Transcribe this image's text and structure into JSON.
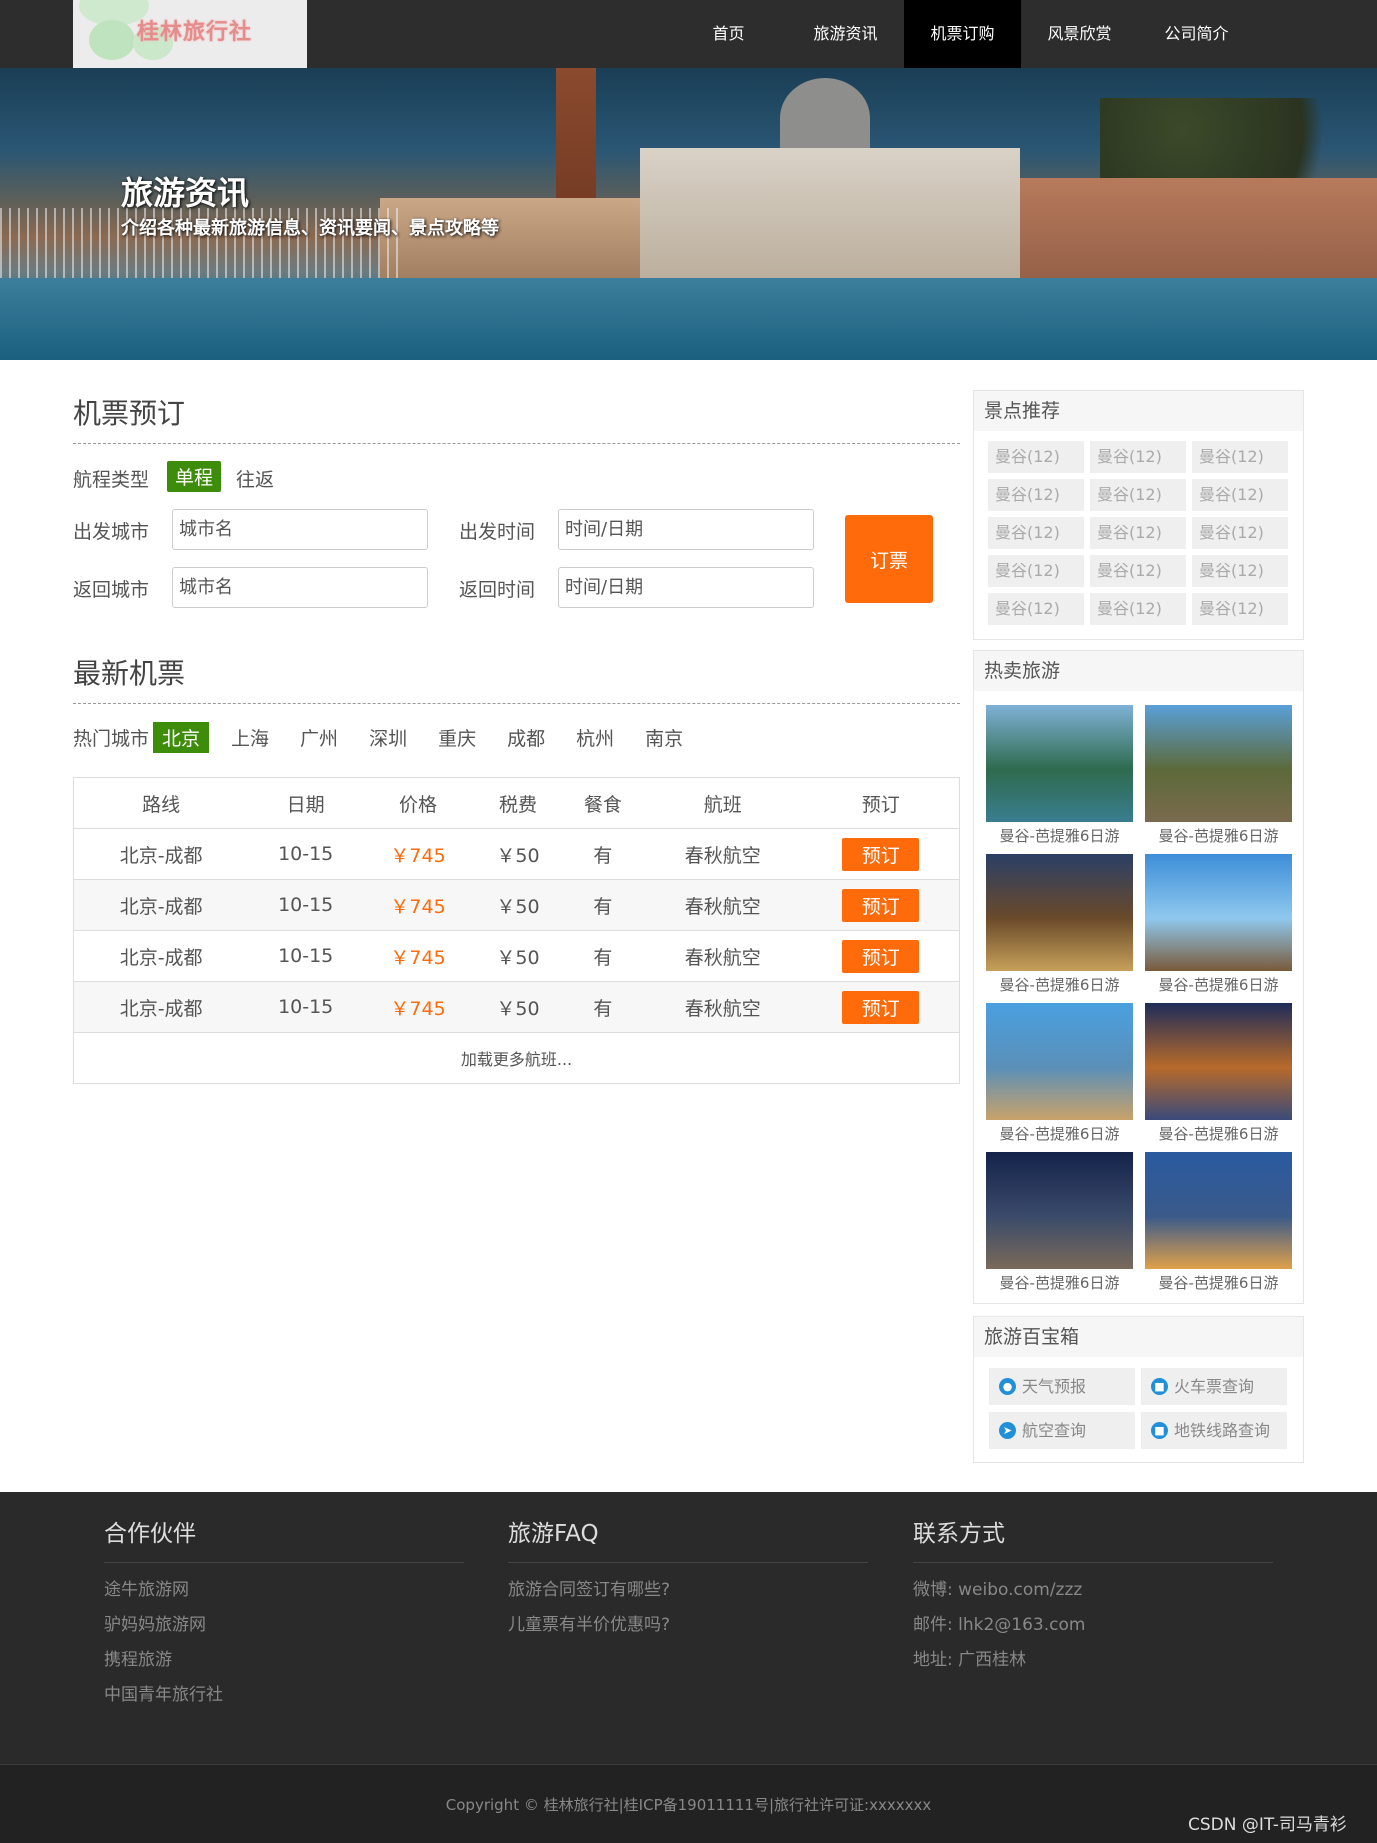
{
  "nav": {
    "logo_text": "桂林旅行社",
    "items": [
      "首页",
      "旅游资讯",
      "机票订购",
      "风景欣赏",
      "公司简介"
    ],
    "active_index": 2
  },
  "banner": {
    "title": "旅游资讯",
    "subtitle": "介绍各种最新旅游信息、资讯要闻、景点攻略等"
  },
  "booking": {
    "title": "机票预订",
    "trip_type_label": "航程类型",
    "trip_types": [
      "单程",
      "往返"
    ],
    "depart_city_label": "出发城市",
    "depart_city_placeholder": "城市名",
    "depart_time_label": "出发时间",
    "depart_time_placeholder": "时间/日期",
    "return_city_label": "返回城市",
    "return_city_placeholder": "城市名",
    "return_time_label": "返回时间",
    "return_time_placeholder": "时间/日期",
    "submit_label": "订票"
  },
  "latest": {
    "title": "最新机票",
    "hot_city_label": "热门城市",
    "cities": [
      "北京",
      "上海",
      "广州",
      "深圳",
      "重庆",
      "成都",
      "杭州",
      "南京"
    ],
    "columns": [
      "路线",
      "日期",
      "价格",
      "税费",
      "餐食",
      "航班",
      "预订"
    ],
    "rows": [
      {
        "route": "北京-成都",
        "date": "10-15",
        "price": "￥745",
        "tax": "￥50",
        "meal": "有",
        "airline": "春秋航空",
        "action": "预订"
      },
      {
        "route": "北京-成都",
        "date": "10-15",
        "price": "￥745",
        "tax": "￥50",
        "meal": "有",
        "airline": "春秋航空",
        "action": "预订"
      },
      {
        "route": "北京-成都",
        "date": "10-15",
        "price": "￥745",
        "tax": "￥50",
        "meal": "有",
        "airline": "春秋航空",
        "action": "预订"
      },
      {
        "route": "北京-成都",
        "date": "10-15",
        "price": "￥745",
        "tax": "￥50",
        "meal": "有",
        "airline": "春秋航空",
        "action": "预订"
      }
    ],
    "load_more": "加载更多航班..."
  },
  "sidebar": {
    "spots_title": "景点推荐",
    "spots": [
      "曼谷(12)",
      "曼谷(12)",
      "曼谷(12)",
      "曼谷(12)",
      "曼谷(12)",
      "曼谷(12)",
      "曼谷(12)",
      "曼谷(12)",
      "曼谷(12)",
      "曼谷(12)",
      "曼谷(12)",
      "曼谷(12)",
      "曼谷(12)",
      "曼谷(12)",
      "曼谷(12)"
    ],
    "hot_title": "热卖旅游",
    "hot": [
      {
        "caption": "曼谷-芭提雅6日游",
        "colors": [
          "#7fb1d6",
          "#2e6b4e",
          "#3a7d8f"
        ]
      },
      {
        "caption": "曼谷-芭提雅6日游",
        "colors": [
          "#5aa0d8",
          "#5c6a3a",
          "#7a6a4e"
        ]
      },
      {
        "caption": "曼谷-芭提雅6日游",
        "colors": [
          "#2b3f66",
          "#6a4a2a",
          "#c7a15a"
        ]
      },
      {
        "caption": "曼谷-芭提雅6日游",
        "colors": [
          "#3d8ed8",
          "#8fc8ee",
          "#7a5a3a"
        ]
      },
      {
        "caption": "曼谷-芭提雅6日游",
        "colors": [
          "#4aa0e0",
          "#5a8fb8",
          "#c9a26a"
        ]
      },
      {
        "caption": "曼谷-芭提雅6日游",
        "colors": [
          "#1e2c5a",
          "#b86a2a",
          "#3a4a7a"
        ]
      },
      {
        "caption": "曼谷-芭提雅6日游",
        "colors": [
          "#14234a",
          "#3a4a6a",
          "#7a6a5a"
        ]
      },
      {
        "caption": "曼谷-芭提雅6日游",
        "colors": [
          "#2a5aa0",
          "#3a5a8a",
          "#e0a04a"
        ]
      }
    ],
    "tools_title": "旅游百宝箱",
    "tools": [
      {
        "label": "天气预报",
        "icon": "location-icon",
        "glyph": "●"
      },
      {
        "label": "火车票查询",
        "icon": "train-icon",
        "glyph": "■"
      },
      {
        "label": "航空查询",
        "icon": "plane-icon",
        "glyph": "➤"
      },
      {
        "label": "地铁线路查询",
        "icon": "subway-icon",
        "glyph": "■"
      }
    ]
  },
  "footer": {
    "partners_title": "合作伙伴",
    "partners": [
      "途牛旅游网",
      "驴妈妈旅游网",
      "携程旅游",
      "中国青年旅行社"
    ],
    "faq_title": "旅游FAQ",
    "faq": [
      "旅游合同签订有哪些?",
      "儿童票有半价优惠吗?"
    ],
    "contact_title": "联系方式",
    "contact": [
      "微博: weibo.com/zzz",
      "邮件: lhk2@163.com",
      "地址: 广西桂林"
    ],
    "copyright": "Copyright © 桂林旅行社|桂ICP备19011111号|旅行社许可证:xxxxxxx"
  },
  "watermark": "CSDN @IT-司马青衫",
  "colors": {
    "accent_orange": "#ff6a0a",
    "accent_green": "#3d8c0a",
    "nav_bg": "#2d2d2d",
    "footer_bg": "#2a2a2a"
  }
}
